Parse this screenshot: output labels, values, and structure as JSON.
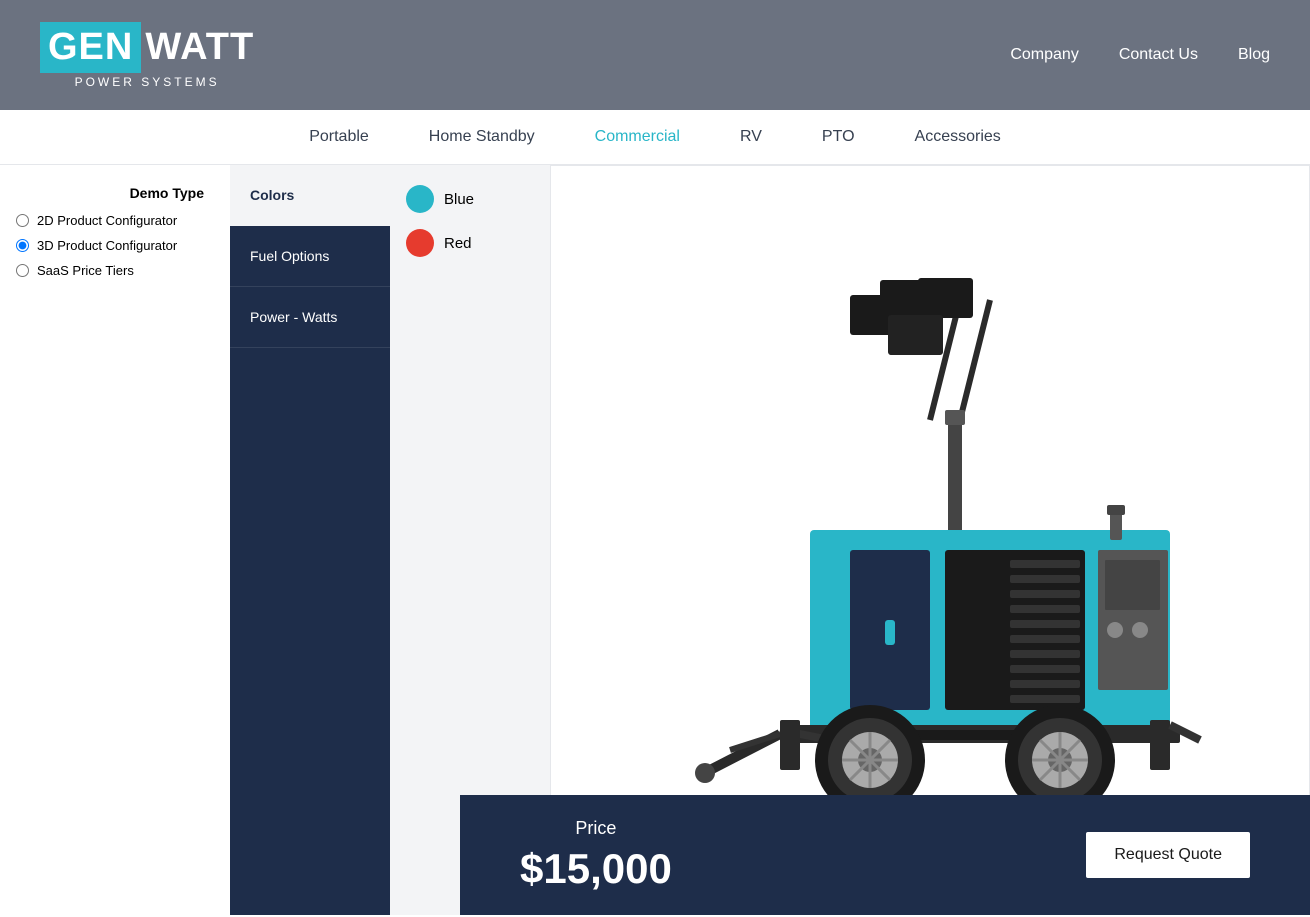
{
  "header": {
    "logo_gen": "GEN",
    "logo_watt": "WATT",
    "logo_sub": "POWER SYSTEMS",
    "nav_items": [
      {
        "label": "Company",
        "href": "#"
      },
      {
        "label": "Contact Us",
        "href": "#"
      },
      {
        "label": "Blog",
        "href": "#"
      }
    ]
  },
  "nav_bar": {
    "items": [
      {
        "label": "Portable",
        "active": false
      },
      {
        "label": "Home Standby",
        "active": false
      },
      {
        "label": "Commercial",
        "active": true
      },
      {
        "label": "RV",
        "active": false
      },
      {
        "label": "PTO",
        "active": false
      },
      {
        "label": "Accessories",
        "active": false
      }
    ]
  },
  "demo_type": {
    "label": "Demo Type",
    "options": [
      {
        "label": "2D Product Configurator",
        "selected": false
      },
      {
        "label": "3D Product Configurator",
        "selected": true
      },
      {
        "label": "SaaS Price Tiers",
        "selected": false
      }
    ]
  },
  "config_sidebar": {
    "items": [
      {
        "label": "Colors",
        "active": true
      },
      {
        "label": "Fuel Options",
        "active": false
      },
      {
        "label": "Power - Watts",
        "active": false
      }
    ]
  },
  "color_options": [
    {
      "label": "Blue",
      "color_class": "blue"
    },
    {
      "label": "Red",
      "color_class": "red"
    }
  ],
  "price_bar": {
    "price_label": "Price",
    "price_value": "$15,000",
    "button_label": "Request Quote"
  }
}
